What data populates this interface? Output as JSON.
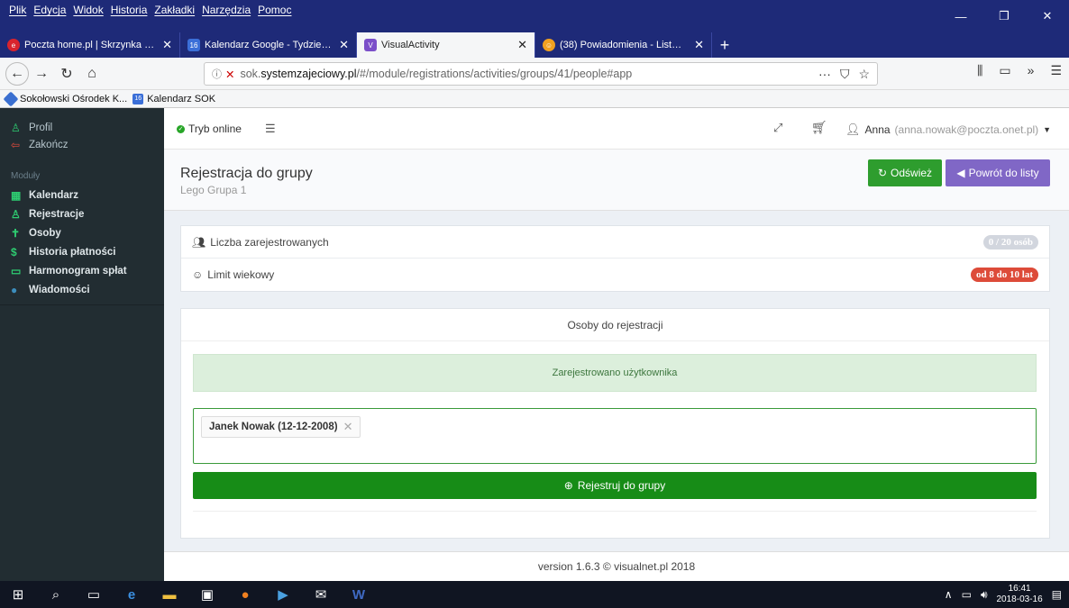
{
  "browser": {
    "menu": [
      "Plik",
      "Edycja",
      "Widok",
      "Historia",
      "Zakładki",
      "Narzędzia",
      "Pomoc"
    ],
    "tabs": [
      {
        "title": "Poczta home.pl | Skrzynka odbi",
        "icon_color": "#d9232d",
        "icon_text": "e"
      },
      {
        "title": "Kalendarz Google - Tydzień, w",
        "icon_color": "#3b6fd8",
        "icon_text": "16"
      },
      {
        "title": "VisualActivity",
        "icon_color": "#7b4fc9",
        "icon_text": "V"
      },
      {
        "title": "(38) Powiadomienia - Lista wia",
        "icon_color": "#f0a020",
        "icon_text": "☺"
      }
    ],
    "url_prefix": "sok.",
    "url_domain": "systemzajeciowy.pl",
    "url_path": "/#/module/registrations/activities/groups/41/people#app",
    "bookmarks": [
      {
        "label": "Sokołowski Ośrodek K...",
        "icon_color": "#3a6fd0"
      },
      {
        "label": "Kalendarz SOK",
        "icon_color": "#3b6fd8",
        "icon_text": "16"
      }
    ]
  },
  "sidebar": {
    "top_items": [
      {
        "label": "Profil",
        "icon": "user-icon"
      },
      {
        "label": "Zakończ",
        "icon": "sign-out-icon"
      }
    ],
    "section_label": "Moduły",
    "modules": [
      {
        "label": "Kalendarz",
        "icon": "calendar-icon"
      },
      {
        "label": "Rejestracje",
        "icon": "user-icon"
      },
      {
        "label": "Osoby",
        "icon": "person-icon"
      },
      {
        "label": "Historia płatności",
        "icon": "dollar-icon"
      },
      {
        "label": "Harmonogram spłat",
        "icon": "calendar-o-icon"
      },
      {
        "label": "Wiadomości",
        "icon": "comments-icon"
      }
    ]
  },
  "topbar": {
    "status": "Tryb online",
    "user_name": "Anna",
    "user_email": "(anna.nowak@poczta.onet.pl)"
  },
  "header": {
    "title": "Rejestracja do grupy",
    "subtitle": "Lego Grupa 1",
    "refresh_label": "Odśwież",
    "back_label": "Powrót do listy"
  },
  "info": {
    "registered_label": "Liczba zarejestrowanych",
    "registered_value": "0 / 20 osób",
    "age_label": "Limit wiekowy",
    "age_value": "od 8 do 10 lat"
  },
  "registration": {
    "title": "Osoby do rejestracji",
    "alert": "Zarejestrowano użytkownika",
    "selected_person": "Janek Nowak (12-12-2008)",
    "register_button": "Rejestruj do grupy"
  },
  "footer": {
    "version": "version 1.6.3 © visualnet.pl 2018"
  },
  "taskbar": {
    "time": "16:41",
    "date": "2018-03-16"
  },
  "colors": {
    "brand_purple": "#8067c6",
    "success_green": "#2e9d2e",
    "danger_red": "#dd4b39",
    "sidebar_bg": "#222d32"
  }
}
